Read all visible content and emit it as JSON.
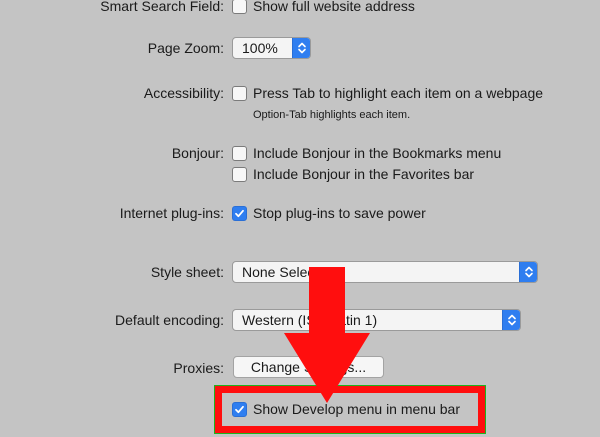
{
  "prefs": {
    "smart_search": {
      "label": "Smart Search Field:",
      "option": "Show full website address",
      "checked": false
    },
    "page_zoom": {
      "label": "Page Zoom:",
      "value": "100%"
    },
    "accessibility": {
      "label": "Accessibility:",
      "option": "Press Tab to highlight each item on a webpage",
      "note": "Option-Tab highlights each item.",
      "checked": false
    },
    "bonjour": {
      "label": "Bonjour:",
      "options": [
        {
          "text": "Include Bonjour in the Bookmarks menu",
          "checked": false
        },
        {
          "text": "Include Bonjour in the Favorites bar",
          "checked": false
        }
      ]
    },
    "plugins": {
      "label": "Internet plug-ins:",
      "option": "Stop plug-ins to save power",
      "checked": true
    },
    "style_sheet": {
      "label": "Style sheet:",
      "value": "None Selected"
    },
    "encoding": {
      "label": "Default encoding:",
      "value": "Western (ISO Latin 1)"
    },
    "proxies": {
      "label": "Proxies:",
      "button": "Change Settings..."
    },
    "develop": {
      "option": "Show Develop menu in menu bar",
      "checked": true
    }
  },
  "colors": {
    "background": "#c4c4c4",
    "accent": "#2f7ef0",
    "highlight": "#ff0e0e"
  },
  "annotation": {
    "icon": "red-down-arrow-icon"
  }
}
